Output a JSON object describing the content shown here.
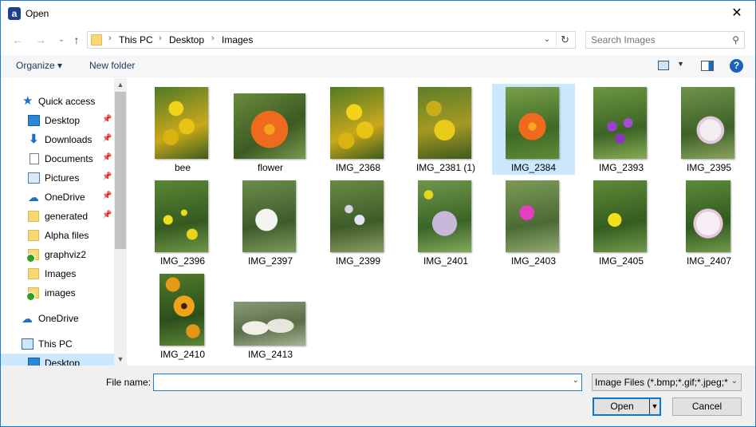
{
  "window": {
    "title": "Open",
    "app_icon": "a"
  },
  "address": {
    "crumbs": [
      "This PC",
      "Desktop",
      "Images"
    ],
    "search_placeholder": "Search Images"
  },
  "toolbar": {
    "organize": "Organize ▾",
    "new_folder": "New folder"
  },
  "sidebar": {
    "items": [
      {
        "label": "Quick access",
        "icon": "star-icon"
      },
      {
        "label": "Desktop",
        "icon": "desktop-icon",
        "pinned": true
      },
      {
        "label": "Downloads",
        "icon": "download-icon",
        "pinned": true
      },
      {
        "label": "Documents",
        "icon": "documents-icon",
        "pinned": true
      },
      {
        "label": "Pictures",
        "icon": "pictures-icon",
        "pinned": true
      },
      {
        "label": "OneDrive",
        "icon": "cloud-icon",
        "pinned": true
      },
      {
        "label": "generated",
        "icon": "folder-icon",
        "pinned": true
      },
      {
        "label": "Alpha files",
        "icon": "folder-icon"
      },
      {
        "label": "graphviz2",
        "icon": "synced-folder-icon"
      },
      {
        "label": "Images",
        "icon": "folder-icon"
      },
      {
        "label": "images",
        "icon": "synced-folder-icon"
      },
      {
        "label": "OneDrive",
        "icon": "cloud-icon"
      },
      {
        "label": "This PC",
        "icon": "computer-icon"
      },
      {
        "label": "Desktop",
        "icon": "desktop-icon"
      }
    ]
  },
  "files": [
    {
      "name": "bee"
    },
    {
      "name": "flower"
    },
    {
      "name": "IMG_2368"
    },
    {
      "name": "IMG_2381 (1)"
    },
    {
      "name": "IMG_2384",
      "selected": true
    },
    {
      "name": "IMG_2393"
    },
    {
      "name": "IMG_2395"
    },
    {
      "name": "IMG_2396"
    },
    {
      "name": "IMG_2397"
    },
    {
      "name": "IMG_2399"
    },
    {
      "name": "IMG_2401"
    },
    {
      "name": "IMG_2403"
    },
    {
      "name": "IMG_2405"
    },
    {
      "name": "IMG_2407"
    },
    {
      "name": "IMG_2410"
    },
    {
      "name": "IMG_2413"
    }
  ],
  "footer": {
    "file_name_label": "File name:",
    "file_name_value": "",
    "filter": "Image Files (*.bmp;*.gif;*.jpeg;*",
    "open": "Open",
    "cancel": "Cancel"
  },
  "colors": {
    "selection": "#cce8ff",
    "accent": "#0078d7"
  }
}
